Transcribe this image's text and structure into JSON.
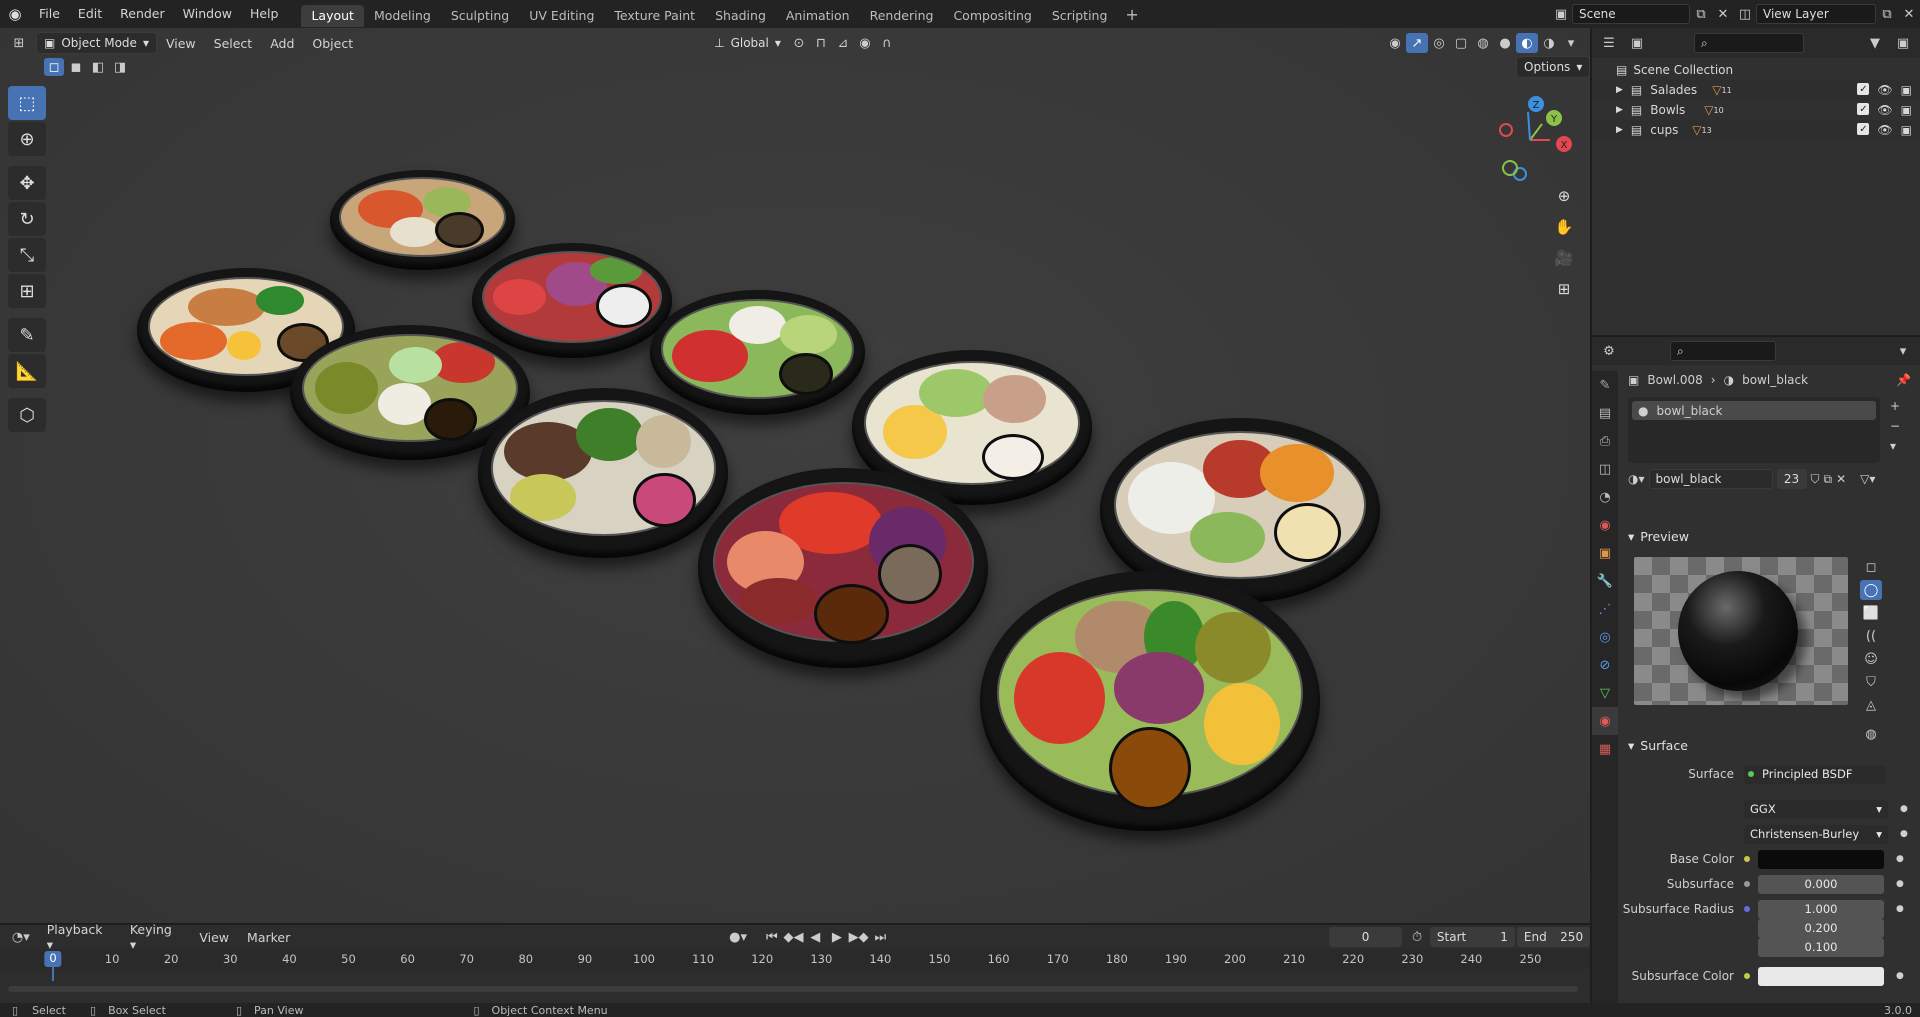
{
  "topbar": {
    "menus": [
      "File",
      "Edit",
      "Render",
      "Window",
      "Help"
    ],
    "workspaces": [
      "Layout",
      "Modeling",
      "Sculpting",
      "UV Editing",
      "Texture Paint",
      "Shading",
      "Animation",
      "Rendering",
      "Compositing",
      "Scripting"
    ],
    "active_workspace": "Layout",
    "add_tab": "+",
    "scene_name": "Scene",
    "view_layer": "View Layer"
  },
  "viewport": {
    "mode": "Object Mode",
    "menus": [
      "View",
      "Select",
      "Add",
      "Object"
    ],
    "transform_orientation": "Global",
    "options_label": "Options",
    "gizmo_axes": {
      "x": "X",
      "y": "Y",
      "z": "Z"
    },
    "colors": {
      "x": "#e5474e",
      "y": "#8bc34a",
      "z": "#3d8fe0"
    }
  },
  "outliner": {
    "root": "Scene Collection",
    "collections": [
      {
        "name": "Salades",
        "count": "11"
      },
      {
        "name": "Bowls",
        "count": "10"
      },
      {
        "name": "cups",
        "count": "13"
      }
    ]
  },
  "properties": {
    "breadcrumb_object": "Bowl.008",
    "breadcrumb_material": "bowl_black",
    "slot_name": "bowl_black",
    "material_name": "bowl_black",
    "users": "23",
    "preview_label": "Preview",
    "surface_panel": "Surface",
    "surface_label": "Surface",
    "surface_shader": "Principled BSDF",
    "distribution": "GGX",
    "subsurface_method": "Christensen-Burley",
    "rows": {
      "base_color_label": "Base Color",
      "subsurface_label": "Subsurface",
      "subsurface_value": "0.000",
      "subsurface_radius_label": "Subsurface Radius",
      "radius": [
        "1.000",
        "0.200",
        "0.100"
      ],
      "subsurface_color_label": "Subsurface Color"
    },
    "colors": {
      "base_color": "#0b0b0b",
      "subsurface_color": "#e8e8e8"
    }
  },
  "timeline": {
    "menus": [
      "Playback",
      "Keying",
      "View",
      "Marker"
    ],
    "current_frame": "0",
    "start_label": "Start",
    "start": "1",
    "end_label": "End",
    "end": "250",
    "ticks": [
      "0",
      "10",
      "20",
      "30",
      "40",
      "50",
      "60",
      "70",
      "80",
      "90",
      "100",
      "110",
      "120",
      "130",
      "140",
      "150",
      "160",
      "170",
      "180",
      "190",
      "200",
      "210",
      "220",
      "230",
      "240",
      "250"
    ]
  },
  "statusbar": {
    "select": "Select",
    "box_select": "Box Select",
    "pan_view": "Pan View",
    "context_menu": "Object Context Menu",
    "version": "3.0.0"
  }
}
